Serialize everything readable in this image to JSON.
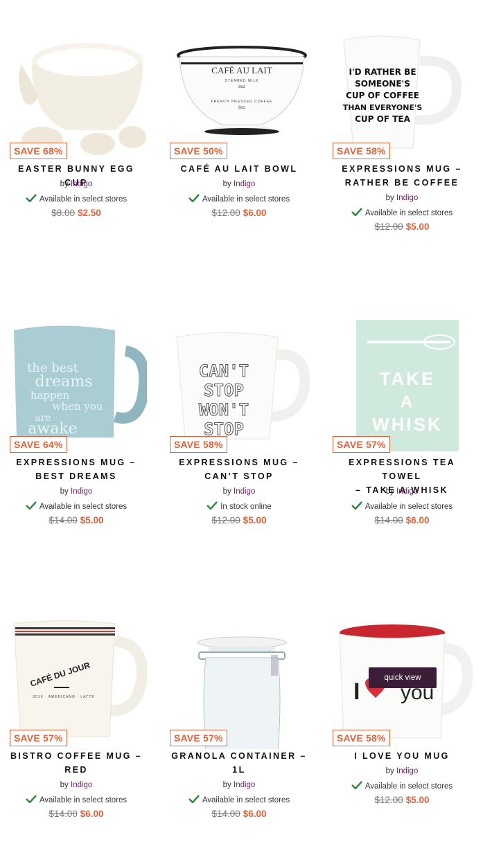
{
  "products": [
    {
      "name": "Easter Bunny Egg Cup",
      "brand_prefix": "by",
      "brand": "Indigo",
      "availability": "Available in select stores",
      "old_price": "$8.00",
      "new_price": "$2.50",
      "save": "SAVE 68%"
    },
    {
      "name": "Café Au Lait Bowl",
      "brand_prefix": "by",
      "brand": "Indigo",
      "availability": "Available in select stores",
      "old_price": "$12.00",
      "new_price": "$6.00",
      "save": "SAVE 50%"
    },
    {
      "name": "Expressions Mug – Rather Be Coffee",
      "brand_prefix": "by",
      "brand": "Indigo",
      "availability": "Available in select stores",
      "old_price": "$12.00",
      "new_price": "$5.00",
      "save": "SAVE 58%"
    },
    {
      "name": "Expressions Mug – Best Dreams",
      "brand_prefix": "by",
      "brand": "Indigo",
      "availability": "Available in select stores",
      "old_price": "$14.00",
      "new_price": "$5.00",
      "save": "SAVE 64%"
    },
    {
      "name": "Expressions Mug – Can’t Stop",
      "brand_prefix": "by",
      "brand": "Indigo",
      "availability": "In stock online",
      "old_price": "$12.00",
      "new_price": "$5.00",
      "save": "SAVE 58%"
    },
    {
      "name": "Expressions Tea Towel – Take A Whisk",
      "brand_prefix": "by",
      "brand": "Indigo",
      "availability": "Available in select stores",
      "old_price": "$14.00",
      "new_price": "$6.00",
      "save": "SAVE 57%"
    },
    {
      "name": "Bistro Coffee Mug – Red",
      "brand_prefix": "by",
      "brand": "Indigo",
      "availability": "Available in select stores",
      "old_price": "$14.00",
      "new_price": "$6.00",
      "save": "SAVE 57%"
    },
    {
      "name": "Granola Container – 1L",
      "brand_prefix": "by",
      "brand": "Indigo",
      "availability": "Available in select stores",
      "old_price": "$14.00",
      "new_price": "$6.00",
      "save": "SAVE 57%"
    },
    {
      "name": "I Love You Mug",
      "brand_prefix": "by",
      "brand": "Indigo",
      "availability": "Available in select stores",
      "old_price": "$12.00",
      "new_price": "$5.00",
      "save": "SAVE 58%"
    }
  ],
  "product_art": {
    "bowl_label": "CAFÉ AU LAIT",
    "bowl_sub1": "STEAMED MILK",
    "bowl_sub2": "8oz",
    "bowl_sub3": "FRENCH PRESSED COFFEE",
    "bowl_sub4": "8oz",
    "mug_rather_lines": [
      "I'D RATHER BE",
      "SOMEONE'S",
      "CUP OF COFFEE",
      "THAN EVERYONE'S",
      "CUP OF TEA"
    ],
    "mug_dreams_lines": [
      "the best",
      "dreams",
      "happen",
      "when you",
      "are",
      "awake"
    ],
    "mug_cantstop_lines": [
      "CAN'T",
      "STOP",
      "WON'T",
      "STOP"
    ],
    "towel_lines": [
      "TAKE",
      "A",
      "WHISK"
    ],
    "bistro_text": "CAFÉ DU JOUR",
    "bistro_sub": "2019 · AMERICANO · LATTE",
    "love_text": "I",
    "love_text2": "you"
  },
  "quick_view_label": "quick view",
  "colors": {
    "accent": "#e1623a",
    "brand_link": "#6d1f63",
    "check": "#2e8b3e",
    "quick_view_bg": "#3b1d38"
  },
  "icons": {
    "availability": "check-icon"
  }
}
